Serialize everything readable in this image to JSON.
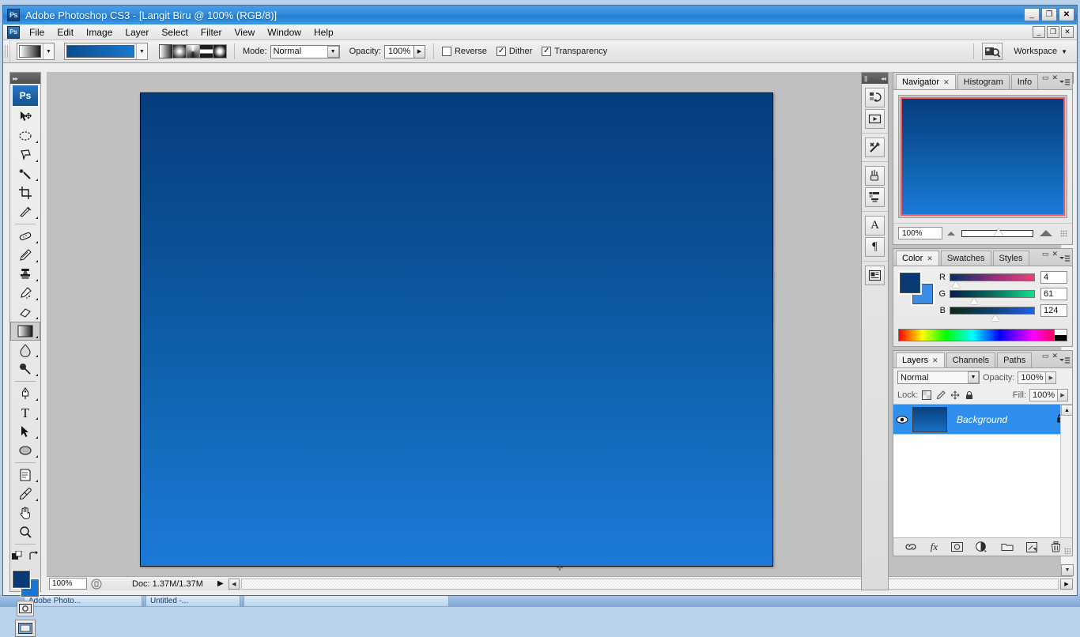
{
  "window": {
    "title": "Adobe Photoshop CS3 - [Langit Biru @ 100% (RGB/8)]",
    "app_badge": "Ps",
    "minimize": "_",
    "maximize": "❐",
    "close": "✕",
    "doc_minimize": "_",
    "doc_restore": "❐",
    "doc_close": "✕"
  },
  "menu": {
    "items": [
      "File",
      "Edit",
      "Image",
      "Layer",
      "Select",
      "Filter",
      "View",
      "Window",
      "Help"
    ]
  },
  "options_bar": {
    "gradient_preset_label": "gradient-preset",
    "gradient_strip_from": "#0b4c8e",
    "gradient_strip_to": "#1878d0",
    "gradient_types": [
      "Linear",
      "Radial",
      "Angle",
      "Reflected",
      "Diamond"
    ],
    "mode_label": "Mode:",
    "mode_value": "Normal",
    "opacity_label": "Opacity:",
    "opacity_value": "100%",
    "reverse_label": "Reverse",
    "reverse_checked": false,
    "dither_label": "Dither",
    "dither_checked": true,
    "transparency_label": "Transparency",
    "transparency_checked": true,
    "bridge_label": "Br",
    "workspace_label": "Workspace"
  },
  "toolbox": {
    "logo": "Ps",
    "tools": [
      {
        "name": "move-tool",
        "glyph": "move"
      },
      {
        "name": "elliptical-marquee-tool",
        "glyph": "ellipse-marquee"
      },
      {
        "name": "lasso-tool",
        "glyph": "lasso"
      },
      {
        "name": "magic-wand-tool",
        "glyph": "wand"
      },
      {
        "name": "crop-tool",
        "glyph": "crop"
      },
      {
        "name": "slice-tool",
        "glyph": "slice"
      },
      {
        "name": "healing-brush-tool",
        "glyph": "healing"
      },
      {
        "name": "brush-tool",
        "glyph": "brush"
      },
      {
        "name": "clone-stamp-tool",
        "glyph": "stamp"
      },
      {
        "name": "history-brush-tool",
        "glyph": "history-brush"
      },
      {
        "name": "eraser-tool",
        "glyph": "eraser"
      },
      {
        "name": "gradient-tool",
        "glyph": "gradient"
      },
      {
        "name": "blur-tool",
        "glyph": "blur"
      },
      {
        "name": "dodge-tool",
        "glyph": "dodge"
      },
      {
        "name": "pen-tool",
        "glyph": "pen"
      },
      {
        "name": "type-tool",
        "glyph": "T"
      },
      {
        "name": "path-selection-tool",
        "glyph": "arrow"
      },
      {
        "name": "ellipse-shape-tool",
        "glyph": "ellipse"
      },
      {
        "name": "notes-tool",
        "glyph": "notes"
      },
      {
        "name": "eyedropper-tool",
        "glyph": "eyedropper"
      },
      {
        "name": "hand-tool",
        "glyph": "hand"
      },
      {
        "name": "zoom-tool",
        "glyph": "zoom"
      }
    ],
    "active_tool": "gradient-tool",
    "foreground_color": "#0a3a73",
    "background_color": "#1a74d6"
  },
  "document": {
    "canvas_gradient_top": "#063d7e",
    "canvas_gradient_bottom": "#1b7ad8",
    "status_zoom": "100%",
    "status_doc": "Doc: 1.37M/1.37M"
  },
  "navigator": {
    "tabs": [
      "Navigator",
      "Histogram",
      "Info"
    ],
    "active_tab": "Navigator",
    "zoom_value": "100%",
    "view_box_color": "#f2585e",
    "thumb_top": "#063d7e",
    "thumb_bottom": "#1b7ad8"
  },
  "color_panel": {
    "tabs": [
      "Color",
      "Swatches",
      "Styles"
    ],
    "active_tab": "Color",
    "foreground_color": "#0a3a73",
    "background_color": "#3d8ce8",
    "channels": [
      {
        "label": "R",
        "value": "4",
        "pos_pct": 2
      },
      {
        "label": "G",
        "value": "61",
        "pos_pct": 24
      },
      {
        "label": "B",
        "value": "124",
        "pos_pct": 49
      }
    ]
  },
  "layers_panel": {
    "tabs": [
      "Layers",
      "Channels",
      "Paths"
    ],
    "active_tab": "Layers",
    "blend_mode": "Normal",
    "opacity_label": "Opacity:",
    "opacity_value": "100%",
    "lock_label": "Lock:",
    "fill_label": "Fill:",
    "fill_value": "100%",
    "layers": [
      {
        "name": "Background",
        "locked": true,
        "visible": true,
        "thumb_top": "#07417f",
        "thumb_bottom": "#1a6fc6"
      }
    ],
    "footer_icons": [
      "link-icon",
      "fx-icon",
      "mask-icon",
      "adjustment-icon",
      "group-icon",
      "new-layer-icon",
      "trash-icon"
    ]
  },
  "icon_dock": {
    "icons": [
      "history-icon",
      "actions-icon",
      "tool-presets-icon",
      "brushes-icon",
      "clone-source-icon",
      "character-icon",
      "paragraph-icon",
      "layer-comps-icon"
    ]
  },
  "taskbar": {
    "items": [
      "Adobe Photo...",
      "Untitled -...",
      ""
    ]
  }
}
